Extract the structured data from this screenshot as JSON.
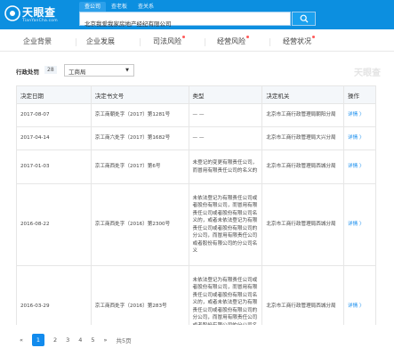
{
  "header": {
    "logo_text": "天眼查",
    "logo_sub": "TianYanCha.com",
    "search_tabs": [
      "查公司",
      "查老板",
      "查关系"
    ],
    "search_value": "北京我爱我家房地产经纪有限公司",
    "colors": {
      "brand": "#0c8fe0",
      "accent": "#128bed"
    }
  },
  "nav": {
    "items": [
      "企业背景",
      "企业发展",
      "司法风险",
      "经营风险",
      "经营状况"
    ]
  },
  "filter": {
    "label": "行政处罚",
    "count": "28",
    "selected": "工商局",
    "watermark": "天眼查"
  },
  "table": {
    "headers": [
      "决定日期",
      "决定书文号",
      "类型",
      "决定机关",
      "操作"
    ],
    "rows": [
      {
        "date": "2017-08-07",
        "doc": "京工商朝处字（2017）第1281号",
        "type": "— —",
        "org": "北京市工商行政管理局朝阳分局",
        "op": "详情 〉"
      },
      {
        "date": "2017-04-14",
        "doc": "京工商六处字（2017）第1682号",
        "type": "— —",
        "org": "北京市工商行政管理局大兴分局",
        "op": "详情 〉"
      },
      {
        "date": "2017-01-03",
        "doc": "京工商西处字（2017）第6号",
        "type": "未登记的变更有限责任公司，而冒用有限责任公司的名义的",
        "org": "北京市工商行政管理局西城分局",
        "op": "详情 〉"
      },
      {
        "date": "2016-08-22",
        "doc": "京工商西处字（2016）第2300号",
        "type": "未依法登记为有限责任公司或者股份有限公司，而冒用有限责任公司或者股份有限公司名义的，或者未依法登记为有限责任公司或者股份有限公司的分公司，而冒用有限责任公司或者股份有限公司的分公司名义",
        "org": "北京市工商行政管理局西城分局",
        "op": "详情 〉"
      },
      {
        "date": "2016-03-29",
        "doc": "京工商西处字（2016）第283号",
        "type": "未依法登记为有限责任公司或者股份有限公司，而冒用有限责任公司或者股份有限公司名义的，或者未依法登记为有限责任公司或者股份有限公司的分公司，而冒用有限责任公司或者股份有限公司的分公司名义",
        "org": "北京市工商行政管理局西城分局",
        "op": "详情 〉"
      }
    ]
  },
  "pager": {
    "prev": "«",
    "pages": [
      "1",
      "2",
      "3",
      "4",
      "5"
    ],
    "next": "»",
    "total": "共5页"
  }
}
